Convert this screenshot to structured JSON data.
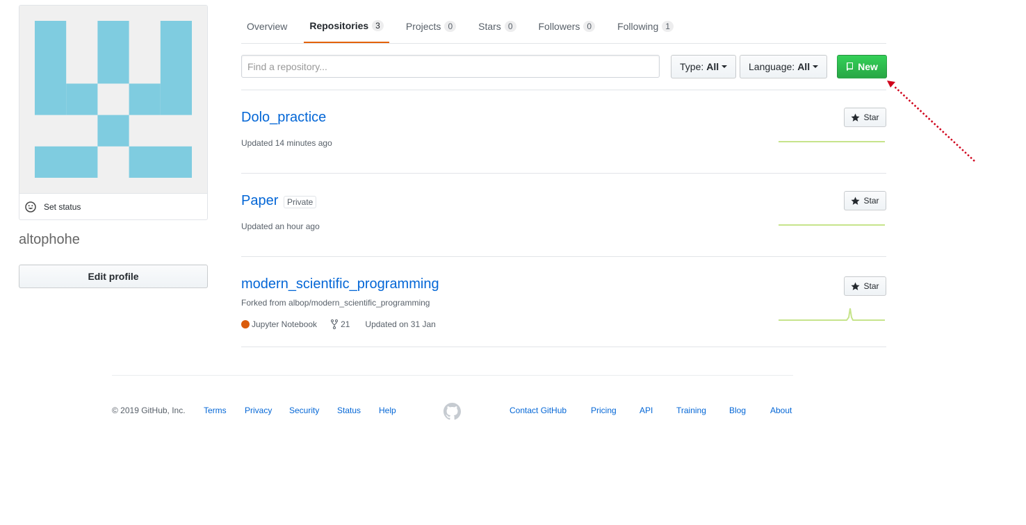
{
  "profile": {
    "username": "altophohe",
    "set_status": "Set status",
    "edit_profile": "Edit profile"
  },
  "tabs": [
    {
      "label": "Overview",
      "count": null
    },
    {
      "label": "Repositories",
      "count": "3"
    },
    {
      "label": "Projects",
      "count": "0"
    },
    {
      "label": "Stars",
      "count": "0"
    },
    {
      "label": "Followers",
      "count": "0"
    },
    {
      "label": "Following",
      "count": "1"
    }
  ],
  "filters": {
    "search_placeholder": "Find a repository...",
    "type_label": "Type:",
    "type_value": "All",
    "language_label": "Language:",
    "language_value": "All",
    "new_label": "New"
  },
  "repos": [
    {
      "name": "Dolo_practice",
      "updated": "Updated 14 minutes ago",
      "star": "Star"
    },
    {
      "name": "Paper",
      "badge": "Private",
      "updated": "Updated an hour ago",
      "star": "Star"
    },
    {
      "name": "modern_scientific_programming",
      "forked_from": "Forked from albop/modern_scientific_programming",
      "language": "Jupyter Notebook",
      "language_color": "#DA5B0B",
      "forks": "21",
      "updated": "Updated on 31 Jan",
      "star": "Star"
    }
  ],
  "footer": {
    "copyright": "© 2019 GitHub, Inc.",
    "left_links": [
      "Terms",
      "Privacy",
      "Security",
      "Status",
      "Help"
    ],
    "right_links": [
      "Contact GitHub",
      "Pricing",
      "API",
      "Training",
      "Blog",
      "About"
    ]
  },
  "colors": {
    "link": "#0366d6",
    "active_tab_underline": "#e36209",
    "new_button": "#28a745",
    "avatar": "#7fcce0",
    "annotation_arrow": "#d0021b"
  },
  "icons": {
    "status": "smiley-icon",
    "new": "repo-icon",
    "star": "star-icon",
    "fork": "fork-icon",
    "footer_logo": "github-mark-icon"
  }
}
